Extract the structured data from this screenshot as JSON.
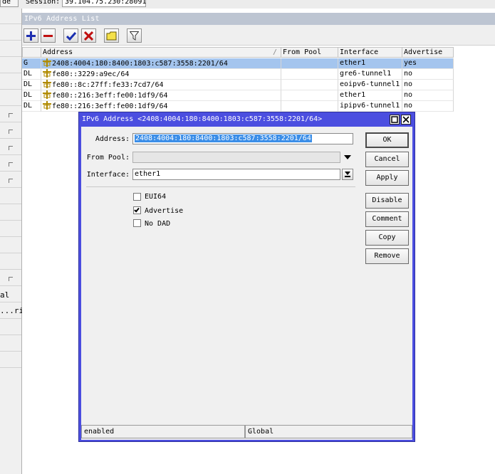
{
  "top": {
    "mode_tab": "de",
    "session_label": "Session:",
    "session_value": "39.104.75.230:28091"
  },
  "sidebar": {
    "text_items": [
      "al",
      "...rif"
    ]
  },
  "list_window": {
    "title": "IPv6 Address List",
    "columns": [
      "",
      "Address",
      "From Pool",
      "Interface",
      "Advertise"
    ],
    "rows": [
      {
        "flags": "G",
        "address": "2408:4004:180:8400:1803:c587:3558:2201/64",
        "from_pool": "",
        "interface": "ether1",
        "advertise": "yes",
        "selected": true
      },
      {
        "flags": "DL",
        "address": "fe80::3229:a9ec/64",
        "from_pool": "",
        "interface": "gre6-tunnel1",
        "advertise": "no",
        "selected": false
      },
      {
        "flags": "DL",
        "address": "fe80::8c:27ff:fe33:7cd7/64",
        "from_pool": "",
        "interface": "eoipv6-tunnel1",
        "advertise": "no",
        "selected": false
      },
      {
        "flags": "DL",
        "address": "fe80::216:3eff:fe00:1df9/64",
        "from_pool": "",
        "interface": "ether1",
        "advertise": "no",
        "selected": false
      },
      {
        "flags": "DL",
        "address": "fe80::216:3eff:fe00:1df9/64",
        "from_pool": "",
        "interface": "ipipv6-tunnel1",
        "advertise": "no",
        "selected": false
      }
    ]
  },
  "dialog": {
    "title": "IPv6 Address <2408:4004:180:8400:1803:c587:3558:2201/64>",
    "address_label": "Address:",
    "address_value": "2408:4004:180:8400:1803:c587:3558:2201/64",
    "from_pool_label": "From Pool:",
    "from_pool_value": "",
    "interface_label": "Interface:",
    "interface_value": "ether1",
    "checkboxes": [
      {
        "label": "EUI64",
        "checked": false
      },
      {
        "label": "Advertise",
        "checked": true
      },
      {
        "label": "No DAD",
        "checked": false
      }
    ],
    "buttons": {
      "ok": "OK",
      "cancel": "Cancel",
      "apply": "Apply",
      "disable": "Disable",
      "comment": "Comment",
      "copy": "Copy",
      "remove": "Remove"
    },
    "status_left": "enabled",
    "status_right": "Global"
  }
}
